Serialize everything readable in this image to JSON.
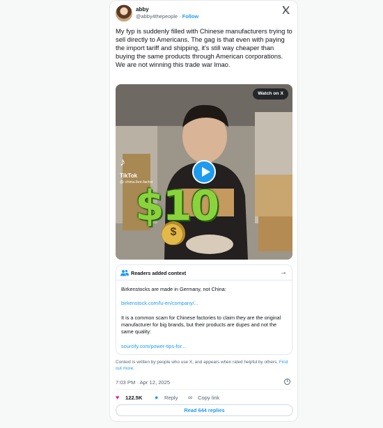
{
  "user": {
    "name": "abby",
    "handle": "@abby4thepeople",
    "separator": "·",
    "follow_label": "Follow"
  },
  "tweet": {
    "text": "My fyp is suddenly filled with Chinese manufacturers trying to sell directly to Americans. The gag is that even with paying the import tariff and shipping, it's still way cheaper than buying the same products through American corporations. We are not winning this trade war lmao."
  },
  "media": {
    "watch_label": "Watch on X",
    "tiktok_label": "TikTok",
    "tiktok_handle": "@ china.live.factor",
    "overlay_price": "$10",
    "moneybag_symbol": "$"
  },
  "notes": {
    "title": "Readers added context",
    "line1": "Birkenstocks are made in Germany, not China:",
    "link1": "birkenstock.com/lu-en/company/...",
    "line2": "It is a common scam for Chinese factories to claim they are the original manufacturer for big brands, but their products are dupes and not the same quality:",
    "link2": "sourcify.com/power-tips-for..."
  },
  "disclaimer": {
    "text": "Context is written by people who use X, and appears when rated helpful by others.",
    "find_out": "Find out more."
  },
  "meta": {
    "timestamp": "7:03 PM · Apr 12, 2025"
  },
  "actions": {
    "likes": "122.5K",
    "reply_label": "Reply",
    "copy_label": "Copy link"
  },
  "replies": {
    "label": "Read 644 replies"
  },
  "colors": {
    "accent": "#1d9bf0",
    "like": "#f91880",
    "price_green": "#8bd33c"
  },
  "icons": [
    "x-logo-icon",
    "people-icon",
    "arrow-right-icon",
    "heart-icon",
    "reply-bubble-icon",
    "link-icon",
    "info-icon",
    "play-icon",
    "tiktok-icon",
    "moneybag-icon"
  ]
}
